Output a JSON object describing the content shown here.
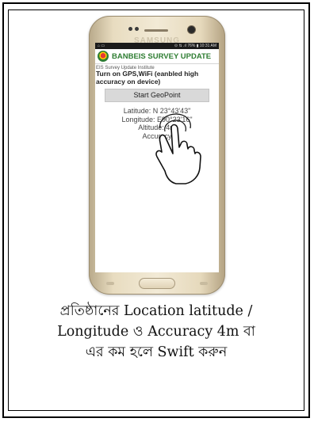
{
  "phone": {
    "brand": "SAMSUNG",
    "status_left": "⌂ ▭",
    "status_right": "⊙ ⇅ .ıl 76% ▮ 10:31 AM"
  },
  "app": {
    "title": "BANBEIS SURVEY UPDATE",
    "subtitle": "EIS Survey Update Institute",
    "instruction": "Turn on GPS,WiFi (eanbled high accuracy on device)",
    "start_button": "Start GeoPoint",
    "latitude": "Latitude: N 23°43'43\"",
    "longitude": "Longitude: E90°23'16\"",
    "altitude": "Altitude: 4m",
    "accuracy": "Accuracy"
  },
  "caption": {
    "line1": "প্রতিষ্ঠানের Location latitude /",
    "line2": "Longitude ও Accuracy 4m বা",
    "line3": "এর কম হলে Swift করুন"
  },
  "colors": {
    "app_title": "#2e7d32",
    "phone_gold": "#e8dcc0"
  }
}
